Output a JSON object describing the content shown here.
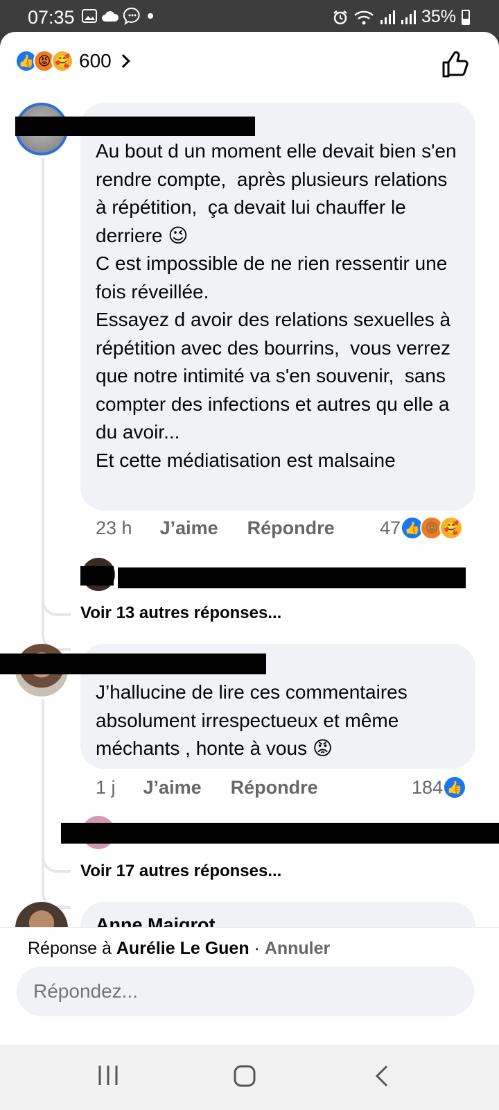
{
  "status_bar": {
    "time": "07:35",
    "battery": "35%",
    "icons": [
      "image-icon",
      "cloud-icon",
      "messenger-icon",
      "dot-icon",
      "alarm-icon",
      "wifi-icon",
      "signal-icon",
      "signal-icon",
      "battery-icon"
    ]
  },
  "header": {
    "reaction_icons": [
      "like-reaction-icon",
      "angry-reaction-icon",
      "care-reaction-icon"
    ],
    "count": "600"
  },
  "comments": [
    {
      "author_visible": "",
      "text": "Au bout d un moment elle devait bien s'en rendre compte,  après plusieurs relations à répétition,  ça devait lui chauffer le derriere 😉\nC est impossible de ne rien ressentir une fois réveillée.\nEssayez d avoir des relations sexuelles à répétition avec des bourrins,  vous verrez que notre intimité va s'en souvenir,  sans compter des infections et autres qu elle a du avoir...\nEt cette médiatisation est malsaine",
      "time": "23 h",
      "like_label": "J’aime",
      "reply_label": "Répondre",
      "reaction_count": "47",
      "more_replies": "Voir 13 autres réponses..."
    },
    {
      "author_visible": "",
      "text": "J’hallucine de lire ces commentaires absolument irrespectueux et même méchants , honte à vous 😡",
      "time": "1 j",
      "like_label": "J’aime",
      "reply_label": "Répondre",
      "reaction_count": "184",
      "more_replies": "Voir 17 autres réponses..."
    },
    {
      "author_visible": "Anne Maigrot"
    }
  ],
  "reply_bar": {
    "prefix": "Réponse à ",
    "name": "Aurélie Le Guen",
    "separator": " · ",
    "cancel": "Annuler",
    "placeholder": "Répondez..."
  },
  "colors": {
    "accent": "#1877f2",
    "bubble": "#f0f2f5",
    "secondary_text": "#65676b"
  }
}
